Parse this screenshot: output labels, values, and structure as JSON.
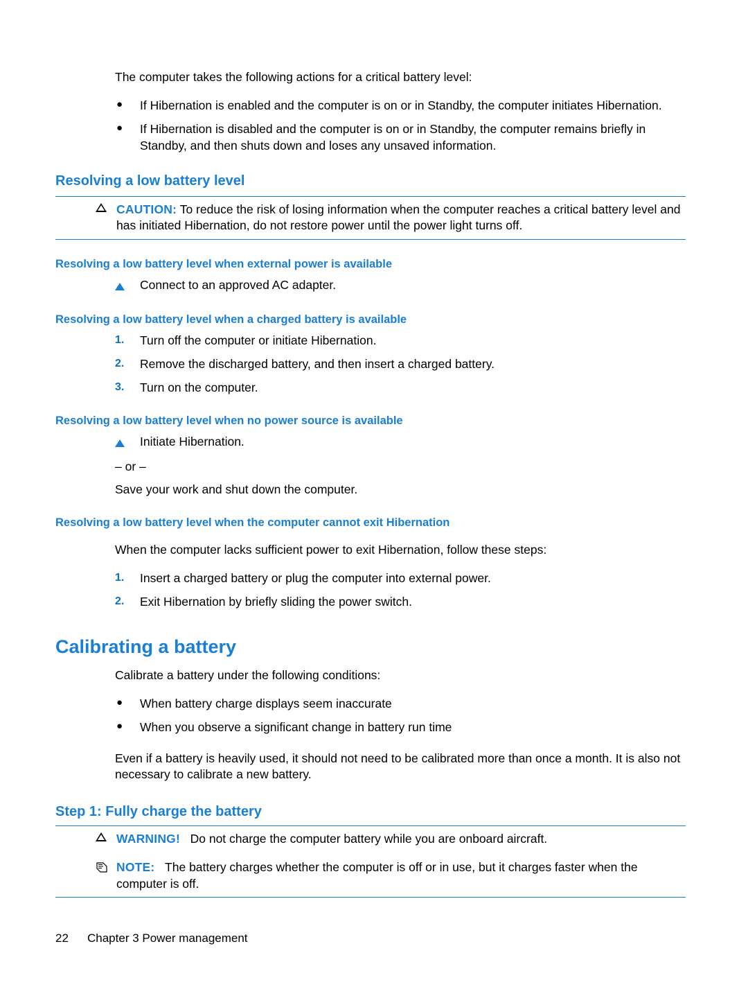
{
  "document": {
    "intro_paragraph": "The computer takes the following actions for a critical battery level:",
    "intro_bullets": [
      "If Hibernation is enabled and the computer is on or in Standby, the computer initiates Hibernation.",
      "If Hibernation is disabled and the computer is on or in Standby, the computer remains briefly in Standby, and then shuts down and loses any unsaved information."
    ],
    "section_resolving": {
      "heading": "Resolving a low battery level",
      "caution": {
        "label": "CAUTION:",
        "text": "To reduce the risk of losing information when the computer reaches a critical battery level and has initiated Hibernation, do not restore power until the power light turns off."
      },
      "sub_external_power": {
        "heading": "Resolving a low battery level when external power is available",
        "step": "Connect to an approved AC adapter."
      },
      "sub_charged_battery": {
        "heading": "Resolving a low battery level when a charged battery is available",
        "steps": [
          {
            "num": "1.",
            "text": "Turn off the computer or initiate Hibernation."
          },
          {
            "num": "2.",
            "text": "Remove the discharged battery, and then insert a charged battery."
          },
          {
            "num": "3.",
            "text": "Turn on the computer."
          }
        ]
      },
      "sub_no_power": {
        "heading": "Resolving a low battery level when no power source is available",
        "step": "Initiate Hibernation.",
        "or_text": "– or –",
        "alt_text": "Save your work and shut down the computer."
      },
      "sub_cannot_exit": {
        "heading": "Resolving a low battery level when the computer cannot exit Hibernation",
        "paragraph": "When the computer lacks sufficient power to exit Hibernation, follow these steps:",
        "steps": [
          {
            "num": "1.",
            "text": "Insert a charged battery or plug the computer into external power."
          },
          {
            "num": "2.",
            "text": "Exit Hibernation by briefly sliding the power switch."
          }
        ]
      }
    },
    "section_calibrating": {
      "heading": "Calibrating a battery",
      "paragraph": "Calibrate a battery under the following conditions:",
      "bullets": [
        "When battery charge displays seem inaccurate",
        "When you observe a significant change in battery run time"
      ],
      "closing_paragraph": "Even if a battery is heavily used, it should not need to be calibrated more than once a month. It is also not necessary to calibrate a new battery.",
      "step1": {
        "heading": "Step 1: Fully charge the battery",
        "warning": {
          "label": "WARNING!",
          "text": "Do not charge the computer battery while you are onboard aircraft."
        },
        "note": {
          "label": "NOTE:",
          "text": "The battery charges whether the computer is off or in use, but it charges faster when the computer is off."
        }
      }
    },
    "footer": {
      "page_number": "22",
      "chapter": "Chapter 3   Power management"
    },
    "colors": {
      "accent_blue": "#1a7fd4",
      "text_black": "#000000",
      "background": "#ffffff"
    },
    "bullet_glyph": "●"
  }
}
